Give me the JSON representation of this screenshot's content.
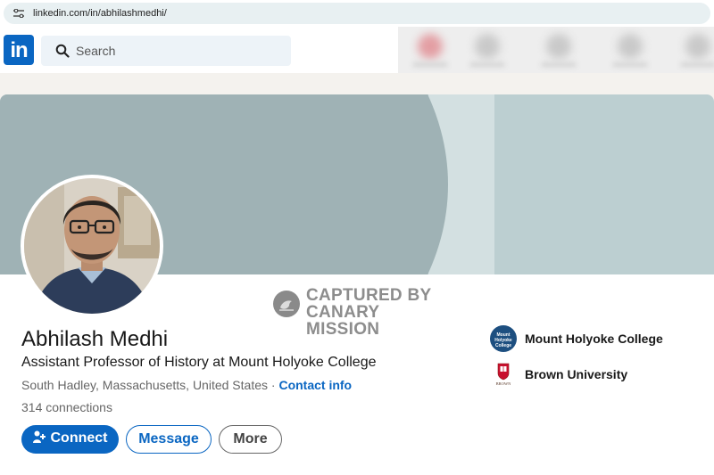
{
  "browser": {
    "url": "linkedin.com/in/abhilashmedhi/"
  },
  "nav": {
    "logo_text": "in",
    "search_placeholder": "Search"
  },
  "watermark": {
    "line1": "CAPTURED BY",
    "line2": "CANARY MISSION"
  },
  "profile": {
    "name": "Abhilash Medhi",
    "headline": "Assistant Professor of History at Mount Holyoke College",
    "location": "South Hadley, Massachusetts, United States",
    "separator": " · ",
    "contact_info": "Contact info",
    "connections": "314 connections"
  },
  "actions": {
    "connect": "Connect",
    "message": "Message",
    "more": "More"
  },
  "organizations": [
    {
      "name": "Mount Holyoke College",
      "logo_text": "Mount Holyoke College",
      "icon": "mount-holyoke-logo"
    },
    {
      "name": "Brown University",
      "logo_text": "BROWN",
      "icon": "brown-university-logo"
    }
  ],
  "colors": {
    "brand": "#0a66c2",
    "banner": "#bccfd1",
    "banner_shape": "#9fb2b5"
  }
}
